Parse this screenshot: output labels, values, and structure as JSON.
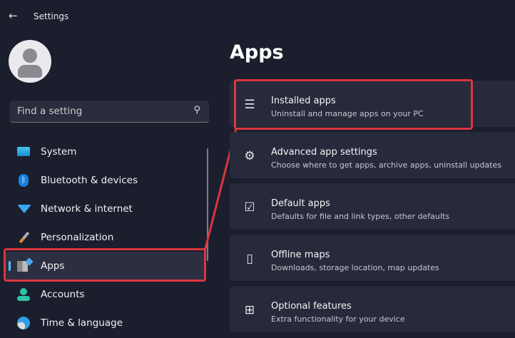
{
  "window": {
    "title": "Settings"
  },
  "search": {
    "placeholder": "Find a setting"
  },
  "nav": [
    {
      "label": "System",
      "icon": "monitor-icon"
    },
    {
      "label": "Bluetooth & devices",
      "icon": "bluetooth-icon"
    },
    {
      "label": "Network & internet",
      "icon": "wifi-icon"
    },
    {
      "label": "Personalization",
      "icon": "brush-icon"
    },
    {
      "label": "Apps",
      "icon": "apps-icon",
      "selected": true
    },
    {
      "label": "Accounts",
      "icon": "person-icon"
    },
    {
      "label": "Time & language",
      "icon": "globe-clock-icon"
    }
  ],
  "page": {
    "title": "Apps"
  },
  "cards": [
    {
      "title": "Installed apps",
      "subtitle": "Uninstall and manage apps on your PC"
    },
    {
      "title": "Advanced app settings",
      "subtitle": "Choose where to get apps, archive apps, uninstall updates"
    },
    {
      "title": "Default apps",
      "subtitle": "Defaults for file and link types, other defaults"
    },
    {
      "title": "Offline maps",
      "subtitle": "Downloads, storage location, map updates"
    },
    {
      "title": "Optional features",
      "subtitle": "Extra functionality for your device"
    }
  ],
  "colors": {
    "accent": "#4cc2ff",
    "highlight": "#d9363e",
    "background": "#1b1e2d"
  }
}
